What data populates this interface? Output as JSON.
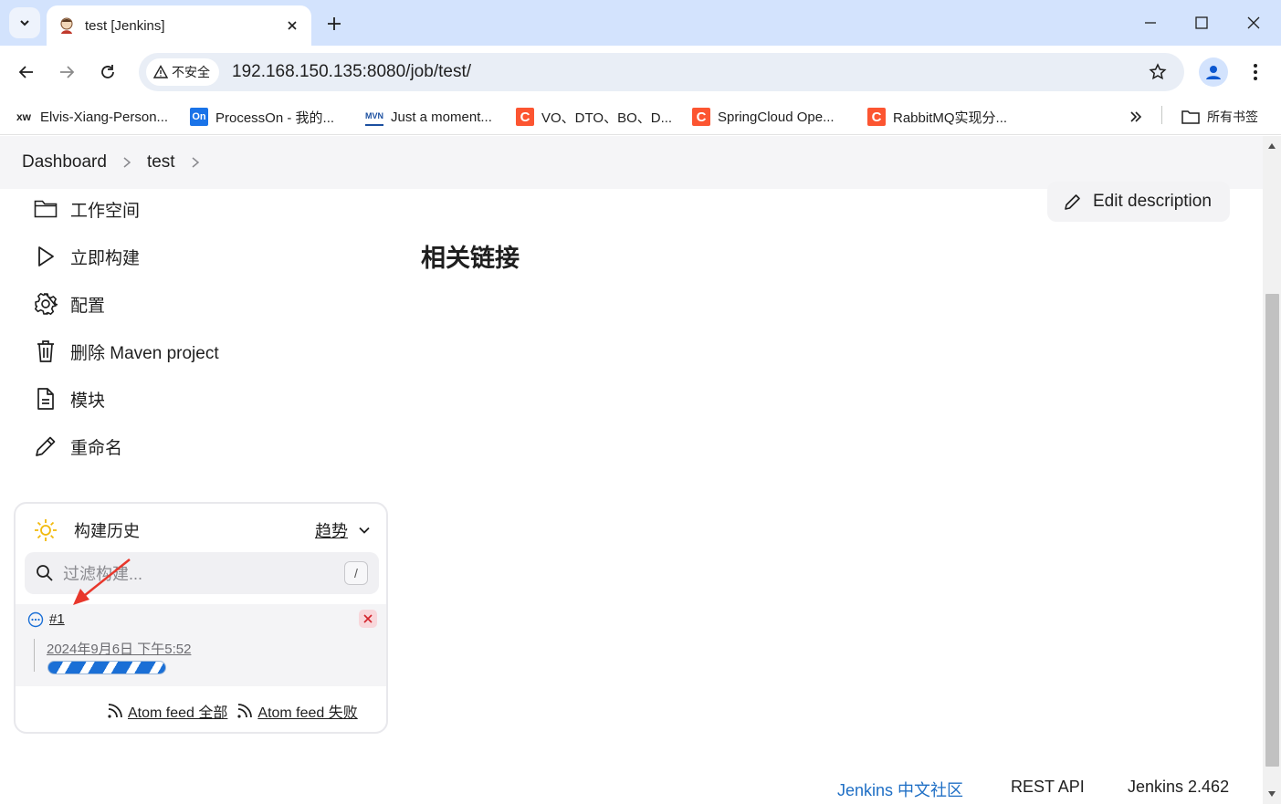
{
  "browser": {
    "tab_title": "test [Jenkins]",
    "security_label": "不安全",
    "url": "192.168.150.135:8080/job/test/",
    "bookmarks": [
      {
        "label": "Elvis-Xiang-Person...",
        "icon": "xw-icon"
      },
      {
        "label": "ProcessOn - 我的...",
        "icon": "processon-icon"
      },
      {
        "label": "Just a moment...",
        "icon": "mvn-icon"
      },
      {
        "label": "VO、DTO、BO、D...",
        "icon": "csdn-icon"
      },
      {
        "label": "SpringCloud Ope...",
        "icon": "csdn-icon"
      },
      {
        "label": "RabbitMQ实现分...",
        "icon": "csdn-icon"
      }
    ],
    "all_bookmarks_label": "所有书签"
  },
  "breadcrumb": [
    "Dashboard",
    "test"
  ],
  "sidebar": {
    "items": [
      {
        "label": "工作空间",
        "icon": "folder-icon"
      },
      {
        "label": "立即构建",
        "icon": "play-icon"
      },
      {
        "label": "配置",
        "icon": "gear-icon"
      },
      {
        "label": "删除 Maven project",
        "icon": "trash-icon"
      },
      {
        "label": "模块",
        "icon": "document-icon"
      },
      {
        "label": "重命名",
        "icon": "pencil-icon"
      }
    ]
  },
  "main": {
    "edit_description": "Edit description",
    "section_title": "相关链接"
  },
  "build_history": {
    "title": "构建历史",
    "trend": "趋势",
    "filter_placeholder": "过滤构建...",
    "shortcut": "/",
    "builds": [
      {
        "number": "#1",
        "time": "2024年9月6日 下午5:52",
        "status": "in-progress"
      }
    ],
    "feeds": [
      "Atom feed 全部",
      "Atom feed 失败"
    ]
  },
  "footer": {
    "community": "Jenkins 中文社区",
    "rest_api": "REST API",
    "version": "Jenkins 2.462"
  },
  "colors": {
    "tabbar": "#d3e3fd",
    "link": "#1f6fc5",
    "progress": "#1a6fd6",
    "annotation_arrow": "#e8372c"
  }
}
